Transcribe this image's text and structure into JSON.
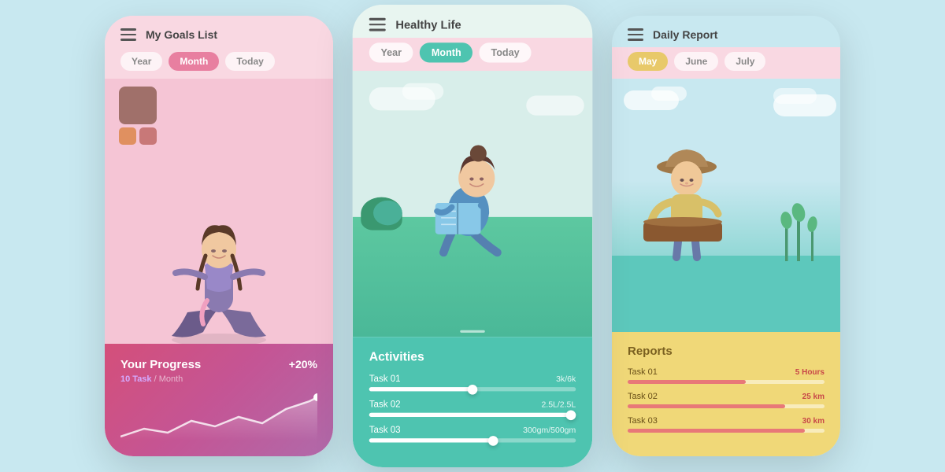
{
  "phone1": {
    "title": "My Goals List",
    "tabs": [
      "Year",
      "Month",
      "Today"
    ],
    "active_tab": 1,
    "progress": {
      "label": "Your Progress",
      "sub_task": "10 Task",
      "sub_period": " / Month",
      "percent": "+20%"
    }
  },
  "phone2": {
    "title": "Healthy Life",
    "tabs": [
      "Year",
      "Month",
      "Today"
    ],
    "active_tab": 1,
    "activities": {
      "label": "Activities",
      "items": [
        {
          "name": "Task 01",
          "value": "3k/6k",
          "fill_pct": 50
        },
        {
          "name": "Task 02",
          "value": "2.5L/2.5L",
          "fill_pct": 100
        },
        {
          "name": "Task 03",
          "value": "300gm/500gm",
          "fill_pct": 60
        }
      ]
    }
  },
  "phone3": {
    "title": "Daily Report",
    "tabs": [
      "May",
      "June",
      "July"
    ],
    "active_tab": 0,
    "reports": {
      "label": "Reports",
      "items": [
        {
          "name": "Task 01",
          "value": "5 Hours",
          "fill_pct": 60
        },
        {
          "name": "Task 02",
          "value": "25 km",
          "fill_pct": 80
        },
        {
          "name": "Task 03",
          "value": "30 km",
          "fill_pct": 90
        }
      ]
    }
  }
}
